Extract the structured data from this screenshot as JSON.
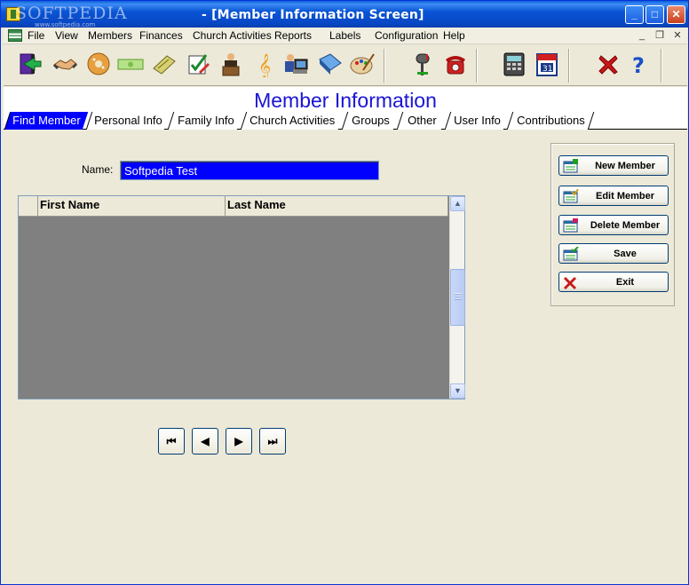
{
  "window": {
    "title": "- [Member Information Screen]",
    "watermark": "SOFTPEDIA",
    "watermark_sub": "www.softpedia.com",
    "controls": {
      "minimize": "_",
      "maximize": "□",
      "close": "✕"
    }
  },
  "menu": {
    "items": [
      "File",
      "View",
      "Members",
      "Finances",
      "Church Activities",
      "Reports",
      "Labels",
      "Configuration",
      "Help"
    ],
    "mdi_controls": [
      "_",
      "❐",
      "✕"
    ]
  },
  "toolbar": {
    "icons": [
      "exit-door-icon",
      "handshake-icon",
      "donut-icon",
      "money-bill-icon",
      "envelope-pen-icon",
      "checklist-icon",
      "pastor-icon",
      "music-note-icon",
      "computer-user-icon",
      "book-icon",
      "paint-palette-icon",
      "mailbox-icon",
      "telephone-icon",
      "calculator-icon",
      "calendar-icon",
      "close-x-icon",
      "help-icon"
    ]
  },
  "heading": "Member Information",
  "tabs": [
    "Find Member",
    "Personal Info",
    "Family Info",
    "Church Activities",
    "Groups",
    "Other",
    "User Info",
    "Contributions"
  ],
  "active_tab": "Find Member",
  "search": {
    "label": "Name:",
    "value": "Softpedia Test"
  },
  "grid": {
    "columns": [
      "First Name",
      "Last Name"
    ],
    "rows": []
  },
  "navigation": {
    "first": "⏮",
    "prev": "◀",
    "next": "▶",
    "last": "⏭"
  },
  "actions": {
    "new_member": "New Member",
    "edit_member": "Edit Member",
    "delete_member": "Delete Member",
    "save": "Save",
    "exit": "Exit"
  },
  "colors": {
    "heading": "#1a14d4",
    "selection": "#0000ff",
    "grid_bg": "#808080"
  }
}
